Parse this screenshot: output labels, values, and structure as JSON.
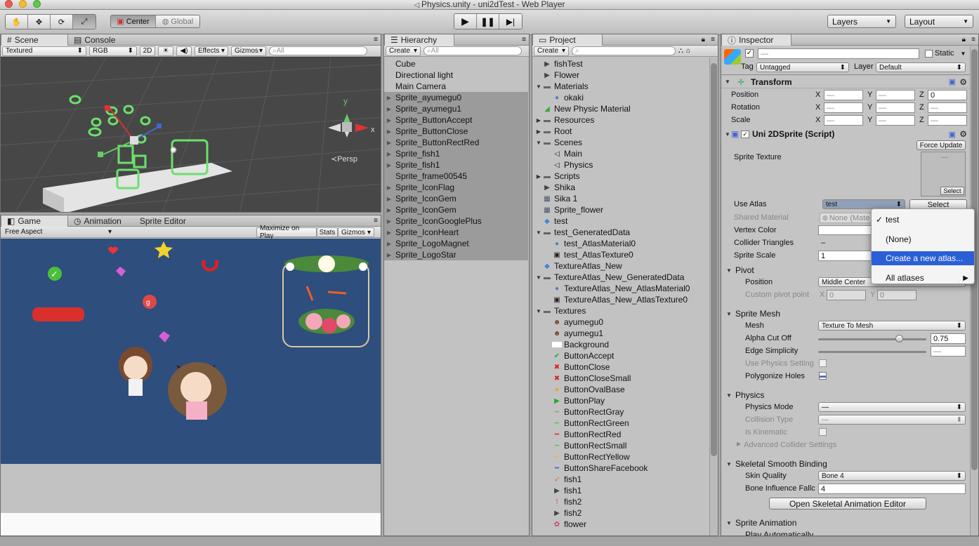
{
  "window": {
    "title": "Physics.unity - uni2dTest - Web Player"
  },
  "toolbar": {
    "center": "Center",
    "global": "Global",
    "layers": "Layers",
    "layout": "Layout",
    "tools": [
      "hand-tool",
      "move-tool",
      "rotate-tool",
      "scale-tool"
    ],
    "play": [
      "play",
      "pause",
      "step"
    ]
  },
  "scene": {
    "tab": "Scene",
    "console_tab": "Console",
    "render_mode": "Textured",
    "color_mode": "RGB",
    "mode_2d": "2D",
    "effects": "Effects",
    "gizmos": "Gizmos",
    "search_placeholder": "All",
    "persp": "Persp",
    "axes": {
      "y": "y",
      "x": "x"
    }
  },
  "game": {
    "tab": "Game",
    "animation_tab": "Animation",
    "sprite_editor_tab": "Sprite Editor",
    "aspect": "Free Aspect",
    "maximize": "Maximize on Play",
    "stats": "Stats",
    "gizmos": "Gizmos",
    "bg_color": "#2e4e7e"
  },
  "hierarchy": {
    "tab": "Hierarchy",
    "create": "Create",
    "search_placeholder": "All",
    "items": [
      {
        "label": "Cube",
        "arrow": false,
        "sel": false
      },
      {
        "label": "Directional light",
        "arrow": false,
        "sel": false
      },
      {
        "label": "Main Camera",
        "arrow": false,
        "sel": false
      },
      {
        "label": "Sprite_ayumegu0",
        "arrow": true,
        "sel": true
      },
      {
        "label": "Sprite_ayumegu1",
        "arrow": true,
        "sel": true
      },
      {
        "label": "Sprite_ButtonAccept",
        "arrow": true,
        "sel": true
      },
      {
        "label": "Sprite_ButtonClose",
        "arrow": true,
        "sel": true
      },
      {
        "label": "Sprite_ButtonRectRed",
        "arrow": true,
        "sel": true
      },
      {
        "label": "Sprite_fish1",
        "arrow": true,
        "sel": true
      },
      {
        "label": "Sprite_fish1",
        "arrow": true,
        "sel": true
      },
      {
        "label": "Sprite_frame00545",
        "arrow": false,
        "sel": true
      },
      {
        "label": "Sprite_IconFlag",
        "arrow": true,
        "sel": true
      },
      {
        "label": "Sprite_IconGem",
        "arrow": true,
        "sel": true
      },
      {
        "label": "Sprite_IconGem",
        "arrow": true,
        "sel": true
      },
      {
        "label": "Sprite_IconGooglePlus",
        "arrow": true,
        "sel": true
      },
      {
        "label": "Sprite_IconHeart",
        "arrow": true,
        "sel": true
      },
      {
        "label": "Sprite_LogoMagnet",
        "arrow": true,
        "sel": true
      },
      {
        "label": "Sprite_LogoStar",
        "arrow": true,
        "sel": true
      }
    ]
  },
  "project": {
    "tab": "Project",
    "create": "Create",
    "items": [
      {
        "label": "fishTest",
        "d": 0,
        "arrow": "",
        "icon": "play-icon"
      },
      {
        "label": "Flower",
        "d": 0,
        "arrow": "",
        "icon": "play-icon"
      },
      {
        "label": "Materials",
        "d": 0,
        "arrow": "open",
        "icon": "folder-icon"
      },
      {
        "label": "okaki",
        "d": 1,
        "arrow": "",
        "icon": "sphere-icon"
      },
      {
        "label": "New Physic Material",
        "d": 0,
        "arrow": "",
        "icon": "physic-icon"
      },
      {
        "label": "Resources",
        "d": 0,
        "arrow": "closed",
        "icon": "folder-icon"
      },
      {
        "label": "Root",
        "d": 0,
        "arrow": "closed",
        "icon": "folder-icon"
      },
      {
        "label": "Scenes",
        "d": 0,
        "arrow": "open",
        "icon": "folder-icon"
      },
      {
        "label": "Main",
        "d": 1,
        "arrow": "",
        "icon": "unity-icon"
      },
      {
        "label": "Physics",
        "d": 1,
        "arrow": "",
        "icon": "unity-icon"
      },
      {
        "label": "Scripts",
        "d": 0,
        "arrow": "closed",
        "icon": "folder-icon"
      },
      {
        "label": "Shika",
        "d": 0,
        "arrow": "",
        "icon": "play-icon"
      },
      {
        "label": "Sika 1",
        "d": 0,
        "arrow": "",
        "icon": "grid-icon"
      },
      {
        "label": "Sprite_flower",
        "d": 0,
        "arrow": "",
        "icon": "grid-icon"
      },
      {
        "label": "test",
        "d": 0,
        "arrow": "",
        "icon": "cube-icon"
      },
      {
        "label": "test_GeneratedData",
        "d": 0,
        "arrow": "open",
        "icon": "folder-icon"
      },
      {
        "label": "test_AtlasMaterial0",
        "d": 1,
        "arrow": "",
        "icon": "sphere-icon"
      },
      {
        "label": "test_AtlasTexture0",
        "d": 1,
        "arrow": "",
        "icon": "texture-icon"
      },
      {
        "label": "TextureAtlas_New",
        "d": 0,
        "arrow": "",
        "icon": "cube-icon"
      },
      {
        "label": "TextureAtlas_New_GeneratedData",
        "d": 0,
        "arrow": "open",
        "icon": "folder-icon"
      },
      {
        "label": "TextureAtlas_New_AtlasMaterial0",
        "d": 1,
        "arrow": "",
        "icon": "sphere-icon"
      },
      {
        "label": "TextureAtlas_New_AtlasTexture0",
        "d": 1,
        "arrow": "",
        "icon": "texture-icon"
      },
      {
        "label": "Textures",
        "d": 0,
        "arrow": "open",
        "icon": "folder-icon"
      },
      {
        "label": "ayumegu0",
        "d": 1,
        "arrow": "",
        "icon": "girl-icon"
      },
      {
        "label": "ayumegu1",
        "d": 1,
        "arrow": "",
        "icon": "girl-icon"
      },
      {
        "label": "Background",
        "d": 1,
        "arrow": "",
        "icon": "blank-icon"
      },
      {
        "label": "ButtonAccept",
        "d": 1,
        "arrow": "",
        "icon": "accept-icon"
      },
      {
        "label": "ButtonClose",
        "d": 1,
        "arrow": "",
        "icon": "close-icon"
      },
      {
        "label": "ButtonCloseSmall",
        "d": 1,
        "arrow": "",
        "icon": "close-icon"
      },
      {
        "label": "ButtonOvalBase",
        "d": 1,
        "arrow": "",
        "icon": "oval-icon"
      },
      {
        "label": "ButtonPlay",
        "d": 1,
        "arrow": "",
        "icon": "playbtn-icon"
      },
      {
        "label": "ButtonRectGray",
        "d": 1,
        "arrow": "",
        "icon": "bar-gray-icon"
      },
      {
        "label": "ButtonRectGreen",
        "d": 1,
        "arrow": "",
        "icon": "bar-green-icon"
      },
      {
        "label": "ButtonRectRed",
        "d": 1,
        "arrow": "",
        "icon": "bar-red-icon"
      },
      {
        "label": "ButtonRectSmall",
        "d": 1,
        "arrow": "",
        "icon": "bar-green-icon"
      },
      {
        "label": "ButtonRectYellow",
        "d": 1,
        "arrow": "",
        "icon": "bar-yellow-icon"
      },
      {
        "label": "ButtonShareFacebook",
        "d": 1,
        "arrow": "",
        "icon": "bar-blue-icon"
      },
      {
        "label": "fish1",
        "d": 1,
        "arrow": "",
        "icon": "fish-icon"
      },
      {
        "label": "fish1",
        "d": 1,
        "arrow": "",
        "icon": "play-icon"
      },
      {
        "label": "fish2",
        "d": 1,
        "arrow": "",
        "icon": "fish2-icon"
      },
      {
        "label": "fish2",
        "d": 1,
        "arrow": "",
        "icon": "play-icon"
      },
      {
        "label": "flower",
        "d": 1,
        "arrow": "",
        "icon": "flower-icon"
      }
    ]
  },
  "inspector": {
    "tab": "Inspector",
    "name_value": "—",
    "static_label": "Static",
    "tag_label": "Tag",
    "tag_value": "Untagged",
    "layer_label": "Layer",
    "layer_value": "Default",
    "transform": {
      "title": "Transform",
      "position": "Position",
      "rotation": "Rotation",
      "scale": "Scale",
      "x": "X",
      "y": "Y",
      "z": "Z",
      "dash": "—",
      "pos_z": "0"
    },
    "script": {
      "title": "Uni 2DSprite (Script)",
      "force_update": "Force Update",
      "sprite_texture": "Sprite Texture",
      "select": "Select",
      "use_atlas": "Use Atlas",
      "atlas_value": "test",
      "select_btn": "Select",
      "shared_material": "Shared Material",
      "shared_material_value": "None (Mate",
      "vertex_color": "Vertex Color",
      "collider_triangles": "Collider Triangles",
      "collider_triangles_value": "–",
      "sprite_scale": "Sprite Scale",
      "sprite_scale_value": "1"
    },
    "pivot": {
      "title": "Pivot",
      "position": "Position",
      "position_value": "Middle Center",
      "custom": "Custom pivot point",
      "x": "X",
      "y": "Y",
      "x_value": "0",
      "y_value": "0"
    },
    "sprite_mesh": {
      "title": "Sprite Mesh",
      "mesh": "Mesh",
      "mesh_value": "Texture To Mesh",
      "alpha_cut_off": "Alpha Cut Off",
      "alpha_value": "0.75",
      "alpha_fraction": 0.75,
      "edge_simplicity": "Edge Simplicity",
      "edge_value": "—",
      "use_physics": "Use Physics Setting",
      "polygonize": "Polygonize Holes"
    },
    "physics": {
      "title": "Physics",
      "mode": "Physics Mode",
      "mode_value": "—",
      "collision_type": "Collision Type",
      "collision_value": "—",
      "is_kinematic": "Is Kinematic",
      "advanced": "Advanced Collider Settings"
    },
    "skeletal": {
      "title": "Skeletal Smooth Binding",
      "skin_quality": "Skin Quality",
      "skin_value": "Bone 4",
      "bone_influence": "Bone Influence Fallc",
      "bone_influence_value": "4",
      "open_editor": "Open Skeletal Animation Editor"
    },
    "sprite_animation": {
      "title": "Sprite Animation",
      "play_auto": "Play Automatically"
    }
  },
  "atlas_menu": {
    "items": [
      "test",
      "(None)",
      "Create a new atlas...",
      "All atlases"
    ],
    "checked": "✓",
    "arrow": "▶"
  }
}
